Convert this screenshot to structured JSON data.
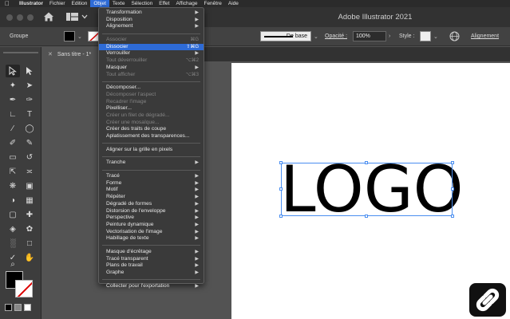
{
  "menubar": {
    "items": [
      "Illustrator",
      "Fichier",
      "Edition",
      "Objet",
      "Texte",
      "Sélection",
      "Effet",
      "Affichage",
      "Fenêtre",
      "Aide"
    ],
    "active": "Objet"
  },
  "appbar": {
    "title": "Adobe Illustrator 2021",
    "traffic_colors": [
      "#5a5a5a",
      "#5a5a5a",
      "#5a5a5a"
    ]
  },
  "controlbar": {
    "selection_label": "Groupe",
    "stroke_style": "De base",
    "opacity_label": "Opacité :",
    "opacity_value": "100%",
    "style_label": "Style :",
    "align_label": "Alignement"
  },
  "document_tab": {
    "title": "Sans titre - 1*"
  },
  "canvas": {
    "logo_text": "LOGO",
    "selection_color": "#4a8ef0"
  },
  "menu": {
    "groups": [
      [
        {
          "label": "Transformation",
          "submenu": true
        },
        {
          "label": "Disposition",
          "submenu": true
        },
        {
          "label": "Alignement",
          "submenu": true
        }
      ],
      [
        {
          "label": "Associer",
          "shortcut": "⌘G",
          "disabled": true
        },
        {
          "label": "Dissocier",
          "shortcut": "⇧⌘G",
          "highlighted": true
        },
        {
          "label": "Verrouiller",
          "submenu": true
        },
        {
          "label": "Tout déverrouiller",
          "shortcut": "⌥⌘2",
          "disabled": true
        },
        {
          "label": "Masquer",
          "submenu": true
        },
        {
          "label": "Tout afficher",
          "shortcut": "⌥⌘3",
          "disabled": true
        }
      ],
      [
        {
          "label": "Décomposer..."
        },
        {
          "label": "Décomposer l'aspect",
          "disabled": true
        },
        {
          "label": "Recadrer l'image",
          "disabled": true
        },
        {
          "label": "Pixelliser..."
        },
        {
          "label": "Créer un filet de dégradé...",
          "disabled": true
        },
        {
          "label": "Créer une mosaïque...",
          "disabled": true
        },
        {
          "label": "Créer des traits de coupe"
        },
        {
          "label": "Aplatissement des transparences..."
        }
      ],
      [
        {
          "label": "Aligner sur la grille en pixels"
        }
      ],
      [
        {
          "label": "Tranche",
          "submenu": true
        }
      ],
      [
        {
          "label": "Tracé",
          "submenu": true
        },
        {
          "label": "Forme",
          "submenu": true
        },
        {
          "label": "Motif",
          "submenu": true
        },
        {
          "label": "Répéter",
          "submenu": true
        },
        {
          "label": "Dégradé de formes",
          "submenu": true
        },
        {
          "label": "Distorsion de l'enveloppe",
          "submenu": true
        },
        {
          "label": "Perspective",
          "submenu": true
        },
        {
          "label": "Peinture dynamique",
          "submenu": true
        },
        {
          "label": "Vectorisation de l'image",
          "submenu": true
        },
        {
          "label": "Habillage de texte",
          "submenu": true
        }
      ],
      [
        {
          "label": "Masque d'écrêtage",
          "submenu": true
        },
        {
          "label": "Tracé transparent",
          "submenu": true
        },
        {
          "label": "Plans de travail",
          "submenu": true
        },
        {
          "label": "Graphe",
          "submenu": true
        }
      ],
      [
        {
          "label": "Collecter pour l'exportation",
          "submenu": true
        }
      ]
    ]
  },
  "icons": {
    "apple": "apple-icon",
    "home": "home-icon",
    "workspace": "workspace-switcher-icon",
    "globe": "recolor-globe-icon",
    "link": "link-chain-icon"
  }
}
